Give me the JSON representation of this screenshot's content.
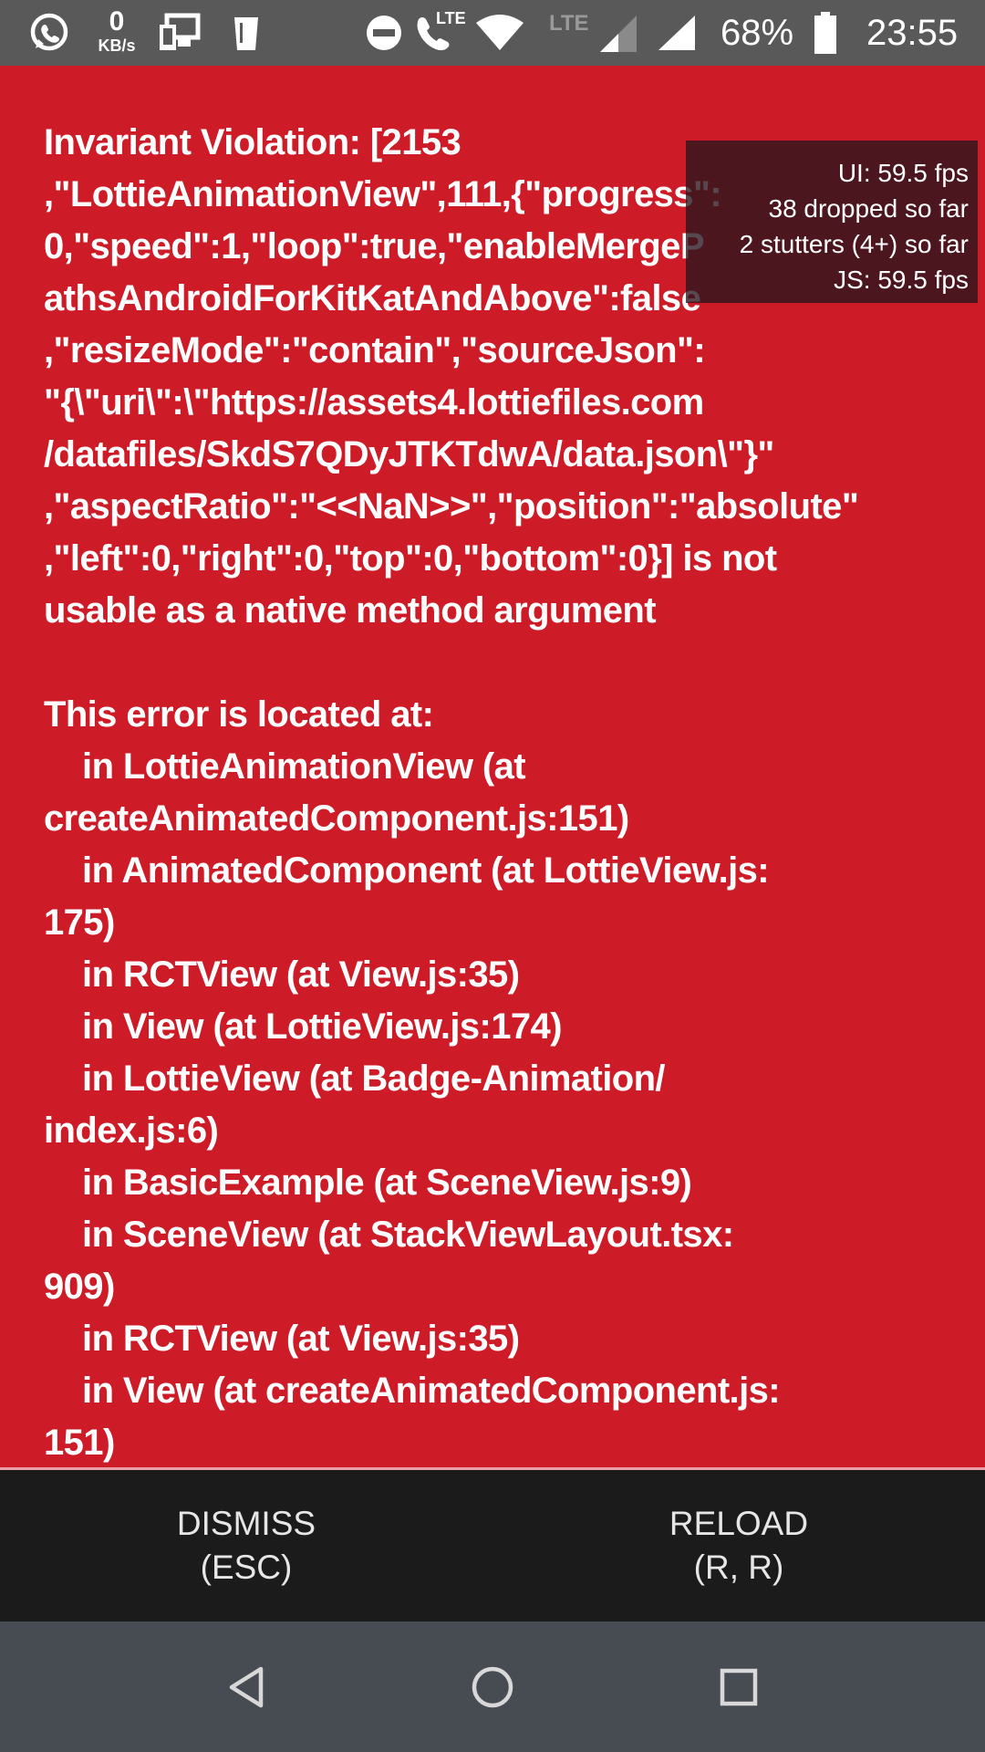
{
  "status_bar": {
    "data_speed_value": "0",
    "data_speed_unit": "KB/s",
    "network_type_1": "LTE",
    "network_type_2": "LTE",
    "battery_percent": "68%",
    "time": "23:55",
    "icons": [
      "whatsapp-icon",
      "data-speed-indicator",
      "screen-cast-icon",
      "trash-icon",
      "do-not-disturb-icon",
      "volte-call-icon",
      "wifi-icon",
      "signal-sim1-icon",
      "signal-sim2-icon",
      "battery-icon"
    ]
  },
  "error": {
    "message": "Invariant Violation: [2153\n,\"LottieAnimationView\",111,{\"progress\":\n0,\"speed\":1,\"loop\":true,\"enableMergeP\nathsAndroidForKitKatAndAbove\":false\n,\"resizeMode\":\"contain\",\"sourceJson\":\n\"{\\\"uri\\\":\\\"https://assets4.lottiefiles.com\n/datafiles/SkdS7QDyJTKTdwA/data.json\\\"}\"\n,\"aspectRatio\":\"<<NaN>>\",\"position\":\"absolute\"\n,\"left\":0,\"right\":0,\"top\":0,\"bottom\":0}] is not\nusable as a native method argument\n\nThis error is located at:\n    in LottieAnimationView (at\ncreateAnimatedComponent.js:151)\n    in AnimatedComponent (at LottieView.js:\n175)\n    in RCTView (at View.js:35)\n    in View (at LottieView.js:174)\n    in LottieView (at Badge-Animation/\nindex.js:6)\n    in BasicExample (at SceneView.js:9)\n    in SceneView (at StackViewLayout.tsx:\n909)\n    in RCTView (at View.js:35)\n    in View (at createAnimatedComponent.js:\n151)"
  },
  "perf_monitor": {
    "ui_fps": "UI: 59.5 fps",
    "dropped": "38 dropped so far",
    "stutters": "2 stutters (4+) so far",
    "js_fps": "JS: 59.5 fps"
  },
  "actions": {
    "dismiss_label": "DISMISS",
    "dismiss_shortcut": "(ESC)",
    "reload_label": "RELOAD",
    "reload_shortcut": "(R, R)"
  },
  "nav_bar": {
    "icons": [
      "back-icon",
      "home-icon",
      "recents-icon"
    ]
  },
  "colors": {
    "error_background": "#cd1b27",
    "status_bar": "#595959",
    "action_bar": "#1b1b1b",
    "nav_bar": "#474b52",
    "text": "#ffffff"
  }
}
